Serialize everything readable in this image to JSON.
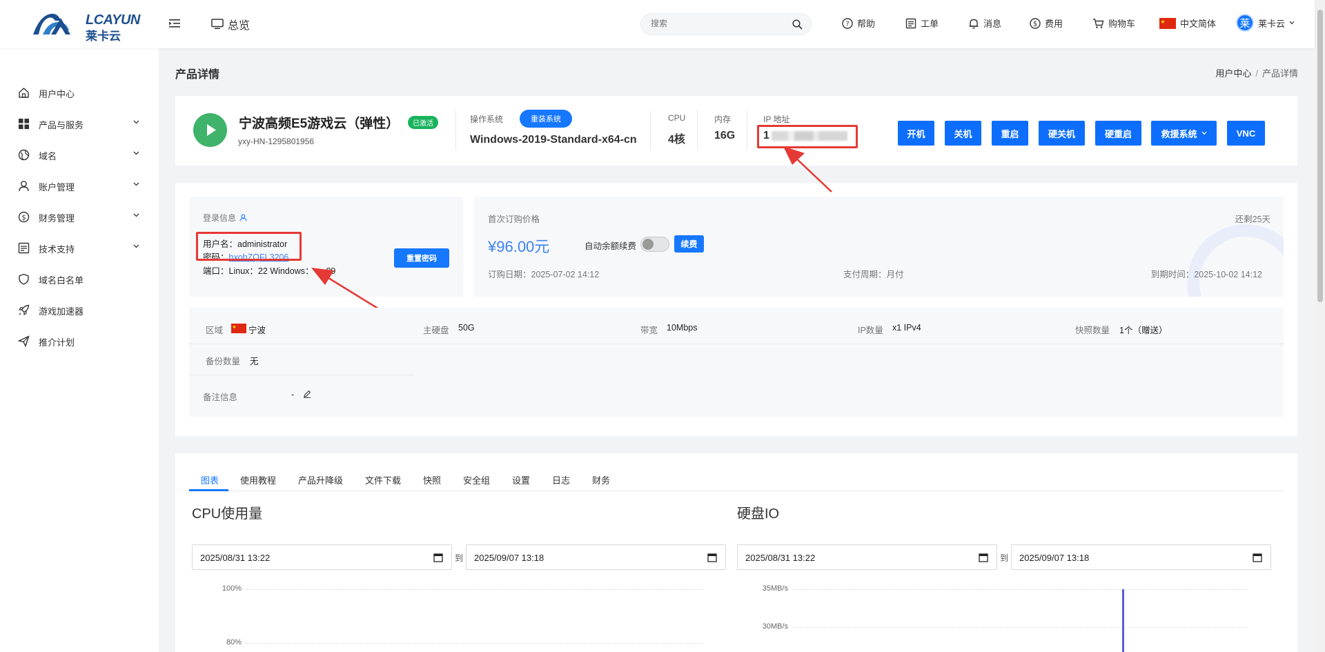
{
  "header": {
    "logo_text": "LCAYUN",
    "logo_sub": "莱卡云",
    "overview": "总览",
    "search_placeholder": "搜索",
    "help": "帮助",
    "ticket": "工单",
    "message": "消息",
    "fee": "费用",
    "cart": "购物车",
    "language": "中文简体",
    "avatar_char": "莱",
    "user": "莱卡云"
  },
  "sidebar": {
    "items": [
      {
        "label": "用户中心",
        "icon": "home-icon"
      },
      {
        "label": "产品与服务",
        "icon": "grid-icon"
      },
      {
        "label": "域名",
        "icon": "globe-icon"
      },
      {
        "label": "账户管理",
        "icon": "user-icon"
      },
      {
        "label": "财务管理",
        "icon": "dollar-icon"
      },
      {
        "label": "技术支持",
        "icon": "document-icon"
      },
      {
        "label": "域名白名单",
        "icon": "shield-icon"
      },
      {
        "label": "游戏加速器",
        "icon": "rocket-icon"
      },
      {
        "label": "推介计划",
        "icon": "send-icon"
      }
    ]
  },
  "page": {
    "title": "产品详情",
    "breadcrumb": [
      "用户中心",
      "产品详情"
    ]
  },
  "product": {
    "name": "宁波高频E5游戏云（弹性）",
    "status": "已激活",
    "id": "yxy-HN-1295801956",
    "os_label": "操作系统",
    "reinstall": "重装系统",
    "os": "Windows-2019-Standard-x64-cn",
    "cpu_label": "CPU",
    "cpu": "4核",
    "mem_label": "内存",
    "mem": "16G",
    "ip_label": "IP 地址",
    "ip_prefix": "1"
  },
  "actions": [
    "开机",
    "关机",
    "重启",
    "硬关机",
    "硬重启",
    "救援系统",
    "VNC"
  ],
  "login": {
    "title": "登录信息",
    "user_label": "用户名：",
    "user": "administrator",
    "pwd_label": "密码：",
    "pwd": "hxohZQFL3206",
    "port_label": "端口：",
    "port": "Linux：22 Windows：",
    "port_tail": "89",
    "reset": "重置密码"
  },
  "order": {
    "first_price_label": "首次订购价格",
    "remaining": "还剩25天",
    "price": "¥96.00元",
    "auto_renew": "自动余额续费",
    "renew": "续费",
    "order_date": "订购日期：2025-07-02 14:12",
    "pay_cycle": "支付周期：月付",
    "expire": "到期时间：2025-10-02 14:12"
  },
  "specs": {
    "region_label": "区域",
    "region": "宁波",
    "disk_label": "主硬盘",
    "disk": "50G",
    "bw_label": "带宽",
    "bw": "10Mbps",
    "ipcount_label": "IP数量",
    "ipcount": "x1 IPv4",
    "snap_label": "快照数量",
    "snap": "1个（赠送）",
    "backup_label": "备份数量",
    "backup": "无",
    "note_label": "备注信息",
    "note": "-"
  },
  "tabs": [
    "图表",
    "使用教程",
    "产品升降级",
    "文件下载",
    "快照",
    "安全组",
    "设置",
    "日志",
    "财务"
  ],
  "charts": {
    "cpu_title": "CPU使用量",
    "disk_title": "硬盘IO",
    "to": "到",
    "start": "2025/08/31  13:22",
    "end": "2025/09/07  13:18",
    "cpu_ticks": [
      "100%",
      "80%"
    ],
    "disk_ticks": [
      "35MB/s",
      "30MB/s"
    ]
  },
  "colors": {
    "accent": "#1677ff",
    "active_badge": "#19b35c",
    "highlight": "#e53935"
  }
}
